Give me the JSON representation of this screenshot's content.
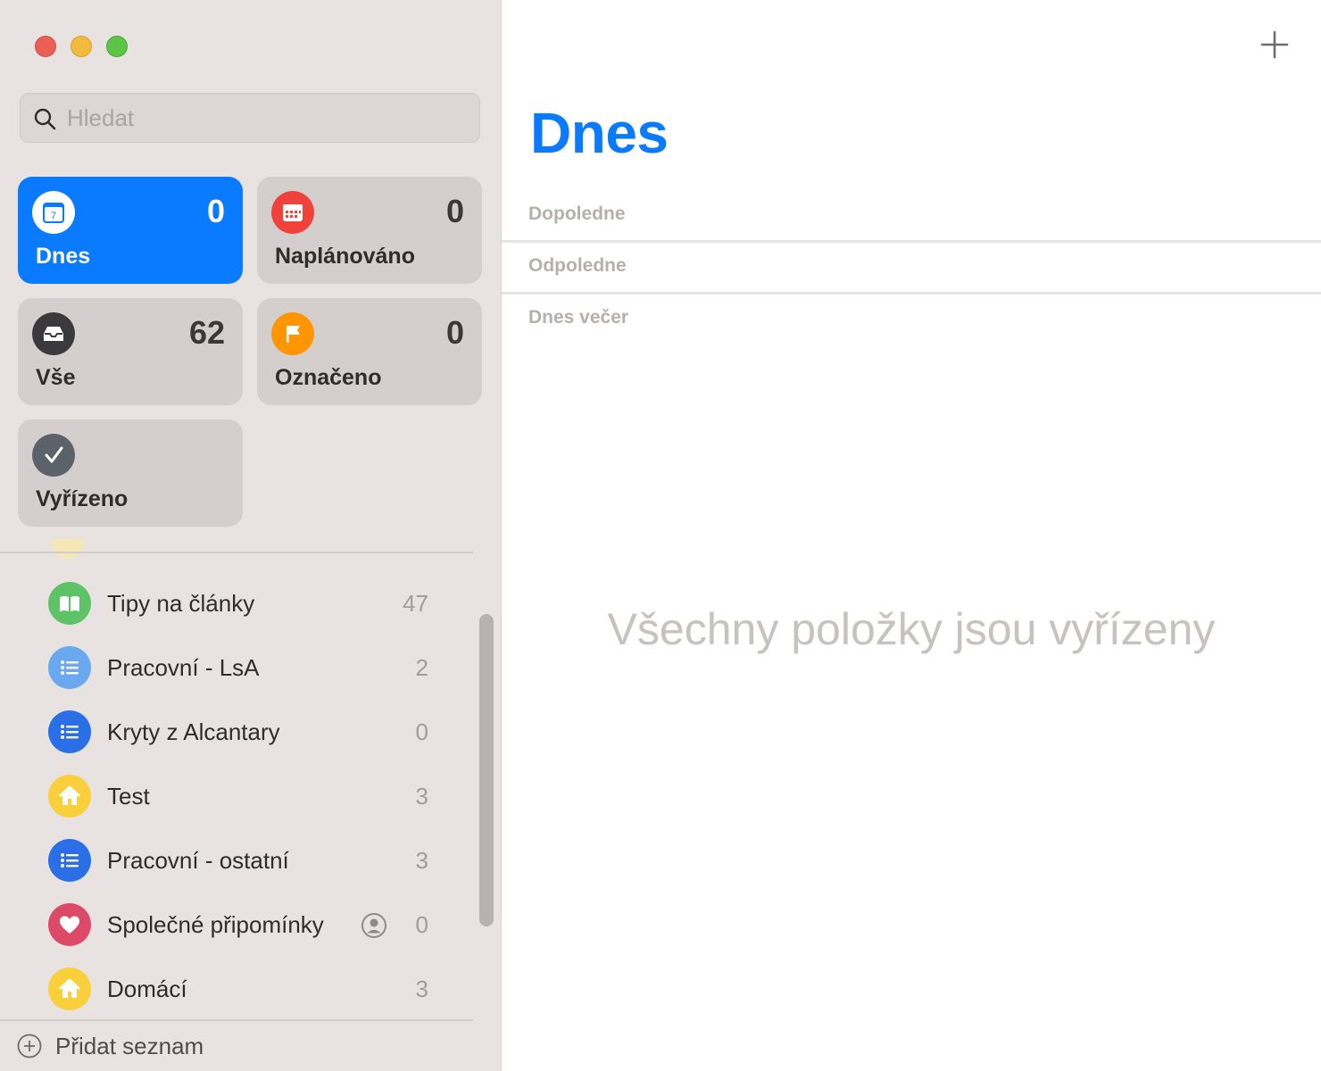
{
  "window": {
    "controls": [
      "close",
      "minimize",
      "maximize"
    ]
  },
  "sidebar": {
    "search": {
      "placeholder": "Hledat",
      "value": ""
    },
    "smart_lists": [
      {
        "label": "Dnes",
        "count": "0",
        "icon": "calendar-today-icon",
        "color": "#0a7aff",
        "active": true
      },
      {
        "label": "Naplánováno",
        "count": "0",
        "icon": "calendar-scheduled-icon",
        "color": "#f0413a",
        "active": false
      },
      {
        "label": "Vše",
        "count": "62",
        "icon": "tray-icon",
        "color": "#3a3a3c",
        "active": false
      },
      {
        "label": "Označeno",
        "count": "0",
        "icon": "flag-icon",
        "color": "#ff9500",
        "active": false
      },
      {
        "label": "Vyřízeno",
        "count": "",
        "icon": "checkmark-icon",
        "color": "#5b626a",
        "active": false
      }
    ],
    "lists": [
      {
        "label": "Tipy na články",
        "count": "47",
        "icon": "book-icon",
        "color": "#5dc366"
      },
      {
        "label": "Pracovní - LsA",
        "count": "2",
        "icon": "list-bullet-icon",
        "color": "#6aa8ef"
      },
      {
        "label": "Kryty z Alcantary",
        "count": "0",
        "icon": "list-bullet-icon",
        "color": "#2b6fe6"
      },
      {
        "label": "Test",
        "count": "3",
        "icon": "house-icon",
        "color": "#f9cf3c"
      },
      {
        "label": "Pracovní - ostatní",
        "count": "3",
        "icon": "list-bullet-icon",
        "color": "#2b6fe6"
      },
      {
        "label": "Společné připomínky",
        "count": "0",
        "icon": "heart-icon",
        "color": "#dc4a68",
        "shared": true
      },
      {
        "label": "Domácí",
        "count": "3",
        "icon": "house-icon",
        "color": "#f9cf3c"
      }
    ],
    "add_list_label": "Přidat seznam"
  },
  "main": {
    "title": "Dnes",
    "sections": [
      {
        "label": "Dopoledne"
      },
      {
        "label": "Odpoledne"
      },
      {
        "label": "Dnes večer"
      }
    ],
    "empty_message": "Všechny položky jsou vyřízeny",
    "accent_color": "#0a7aff"
  }
}
